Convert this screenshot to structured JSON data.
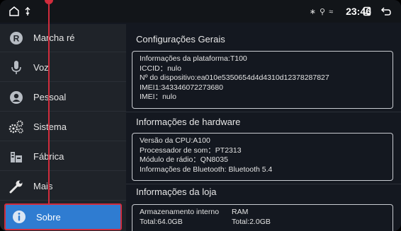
{
  "status_bar": {
    "time": "23:46",
    "cluster_glyphs": "∗ ⚲ ≈"
  },
  "sidebar": {
    "items": [
      {
        "label": "Marcha ré",
        "icon": "reverse-gear-icon"
      },
      {
        "label": "Voz",
        "icon": "microphone-icon"
      },
      {
        "label": "Pessoal",
        "icon": "person-icon"
      },
      {
        "label": "Sistema",
        "icon": "gears-icon"
      },
      {
        "label": "Fábrica",
        "icon": "factory-icon"
      },
      {
        "label": "Mais",
        "icon": "wrench-icon"
      },
      {
        "label": "Sobre",
        "icon": "info-icon",
        "selected": true
      }
    ]
  },
  "sections": {
    "general": {
      "title": "Configurações Gerais",
      "lines": [
        "Informações da plataforma:T100",
        "ICCID：nulo",
        "Nº do dispositivo:ea010e5350654d4d4310d12378287827",
        "IMEI1:343346072273680",
        "IMEI：nulo"
      ]
    },
    "hardware": {
      "title": "Informações de hardware",
      "lines": [
        "Versão da CPU:A100",
        "Processador de som：PT2313",
        "Módulo de rádio：QN8035",
        "Informações de Bluetooth: Bluetooth 5.4"
      ]
    },
    "store": {
      "title": "Informações da loja",
      "internal_label": "Armazenamento interno",
      "internal_value": "Total:64.0GB",
      "ram_label": "RAM",
      "ram_value": "Total:2.0GB"
    }
  },
  "colors": {
    "selected_bg": "#2f7cd1",
    "annotation": "#d12c3c"
  }
}
